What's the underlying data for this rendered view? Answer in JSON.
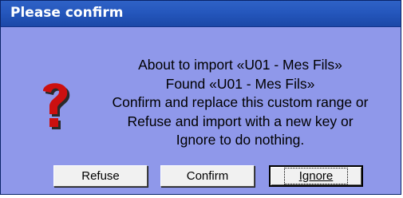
{
  "window": {
    "title": "Please confirm"
  },
  "dialog": {
    "icon": "question-mark-icon",
    "message_lines": [
      "About to import «U01 - Mes Fils»",
      "Found «U01 - Mes Fils»",
      "Confirm and replace this custom range or",
      "Refuse and import with a new key or",
      "Ignore to do nothing."
    ]
  },
  "buttons": {
    "refuse": "Refuse",
    "confirm": "Confirm",
    "ignore": "Ignore"
  },
  "colors": {
    "title_bar": "#2557bd",
    "dialog_background": "#8f98ea",
    "icon_red": "#cc1010"
  }
}
